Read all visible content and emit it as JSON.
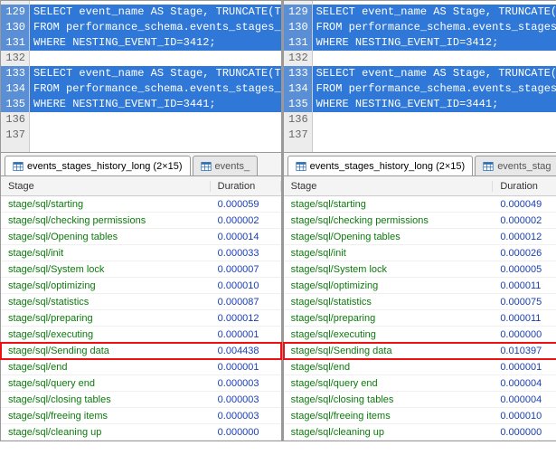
{
  "left": {
    "editor": {
      "lines": [
        {
          "n": "129",
          "text": "SELECT event_name AS Stage, TRUNCATE(T",
          "sel": true
        },
        {
          "n": "130",
          "text": "FROM performance_schema.events_stages_",
          "sel": true
        },
        {
          "n": "131",
          "text": "WHERE NESTING_EVENT_ID=3412;",
          "sel": true
        },
        {
          "n": "132",
          "text": "",
          "sel": false
        },
        {
          "n": "133",
          "text": "SELECT event_name AS Stage, TRUNCATE(T",
          "sel": true
        },
        {
          "n": "134",
          "text": "FROM performance_schema.events_stages_",
          "sel": true
        },
        {
          "n": "135",
          "text": "WHERE NESTING_EVENT_ID=3441;",
          "sel": true
        },
        {
          "n": "136",
          "text": "",
          "sel": false
        },
        {
          "n": "137",
          "text": "",
          "sel": false
        }
      ]
    },
    "tabs": [
      {
        "label": "events_stages_history_long (2×15)",
        "active": true
      },
      {
        "label": "events_",
        "active": false
      }
    ],
    "grid": {
      "headers": {
        "stage": "Stage",
        "duration": "Duration"
      },
      "rows": [
        {
          "stage": "stage/sql/starting",
          "duration": "0.000059",
          "hl": false
        },
        {
          "stage": "stage/sql/checking permissions",
          "duration": "0.000002",
          "hl": false
        },
        {
          "stage": "stage/sql/Opening tables",
          "duration": "0.000014",
          "hl": false
        },
        {
          "stage": "stage/sql/init",
          "duration": "0.000033",
          "hl": false
        },
        {
          "stage": "stage/sql/System lock",
          "duration": "0.000007",
          "hl": false
        },
        {
          "stage": "stage/sql/optimizing",
          "duration": "0.000010",
          "hl": false
        },
        {
          "stage": "stage/sql/statistics",
          "duration": "0.000087",
          "hl": false
        },
        {
          "stage": "stage/sql/preparing",
          "duration": "0.000012",
          "hl": false
        },
        {
          "stage": "stage/sql/executing",
          "duration": "0.000001",
          "hl": false
        },
        {
          "stage": "stage/sql/Sending data",
          "duration": "0.004438",
          "hl": true
        },
        {
          "stage": "stage/sql/end",
          "duration": "0.000001",
          "hl": false
        },
        {
          "stage": "stage/sql/query end",
          "duration": "0.000003",
          "hl": false
        },
        {
          "stage": "stage/sql/closing tables",
          "duration": "0.000003",
          "hl": false
        },
        {
          "stage": "stage/sql/freeing items",
          "duration": "0.000003",
          "hl": false
        },
        {
          "stage": "stage/sql/cleaning up",
          "duration": "0.000000",
          "hl": false
        }
      ]
    }
  },
  "right": {
    "editor": {
      "lines": [
        {
          "n": "129",
          "text": "SELECT event_name AS Stage, TRUNCATE(T",
          "sel": true
        },
        {
          "n": "130",
          "text": "FROM performance_schema.events_stages_",
          "sel": true
        },
        {
          "n": "131",
          "text": "WHERE NESTING_EVENT_ID=3412;",
          "sel": true
        },
        {
          "n": "132",
          "text": "",
          "sel": false
        },
        {
          "n": "133",
          "text": "SELECT event_name AS Stage, TRUNCATE(T",
          "sel": true
        },
        {
          "n": "134",
          "text": "FROM performance_schema.events_stages_",
          "sel": true
        },
        {
          "n": "135",
          "text": "WHERE NESTING_EVENT_ID=3441;",
          "sel": true
        },
        {
          "n": "136",
          "text": "",
          "sel": false
        },
        {
          "n": "137",
          "text": "",
          "sel": false
        }
      ]
    },
    "tabs": [
      {
        "label": "events_stages_history_long (2×15)",
        "active": true
      },
      {
        "label": "events_stag",
        "active": false
      }
    ],
    "grid": {
      "headers": {
        "stage": "Stage",
        "duration": "Duration"
      },
      "rows": [
        {
          "stage": "stage/sql/starting",
          "duration": "0.000049",
          "hl": false
        },
        {
          "stage": "stage/sql/checking permissions",
          "duration": "0.000002",
          "hl": false
        },
        {
          "stage": "stage/sql/Opening tables",
          "duration": "0.000012",
          "hl": false
        },
        {
          "stage": "stage/sql/init",
          "duration": "0.000026",
          "hl": false
        },
        {
          "stage": "stage/sql/System lock",
          "duration": "0.000005",
          "hl": false
        },
        {
          "stage": "stage/sql/optimizing",
          "duration": "0.000011",
          "hl": false
        },
        {
          "stage": "stage/sql/statistics",
          "duration": "0.000075",
          "hl": false
        },
        {
          "stage": "stage/sql/preparing",
          "duration": "0.000011",
          "hl": false
        },
        {
          "stage": "stage/sql/executing",
          "duration": "0.000000",
          "hl": false
        },
        {
          "stage": "stage/sql/Sending data",
          "duration": "0.010397",
          "hl": true
        },
        {
          "stage": "stage/sql/end",
          "duration": "0.000001",
          "hl": false
        },
        {
          "stage": "stage/sql/query end",
          "duration": "0.000004",
          "hl": false
        },
        {
          "stage": "stage/sql/closing tables",
          "duration": "0.000004",
          "hl": false
        },
        {
          "stage": "stage/sql/freeing items",
          "duration": "0.000010",
          "hl": false
        },
        {
          "stage": "stage/sql/cleaning up",
          "duration": "0.000000",
          "hl": false
        }
      ]
    }
  },
  "chart_data": [
    {
      "type": "table",
      "title": "events_stages_history_long (left, NESTING_EVENT_ID=3412)",
      "columns": [
        "Stage",
        "Duration"
      ],
      "rows": [
        [
          "stage/sql/starting",
          5.9e-05
        ],
        [
          "stage/sql/checking permissions",
          2e-06
        ],
        [
          "stage/sql/Opening tables",
          1.4e-05
        ],
        [
          "stage/sql/init",
          3.3e-05
        ],
        [
          "stage/sql/System lock",
          7e-06
        ],
        [
          "stage/sql/optimizing",
          1e-05
        ],
        [
          "stage/sql/statistics",
          8.7e-05
        ],
        [
          "stage/sql/preparing",
          1.2e-05
        ],
        [
          "stage/sql/executing",
          1e-06
        ],
        [
          "stage/sql/Sending data",
          0.004438
        ],
        [
          "stage/sql/end",
          1e-06
        ],
        [
          "stage/sql/query end",
          3e-06
        ],
        [
          "stage/sql/closing tables",
          3e-06
        ],
        [
          "stage/sql/freeing items",
          3e-06
        ],
        [
          "stage/sql/cleaning up",
          0.0
        ]
      ]
    },
    {
      "type": "table",
      "title": "events_stages_history_long (right, NESTING_EVENT_ID=3441)",
      "columns": [
        "Stage",
        "Duration"
      ],
      "rows": [
        [
          "stage/sql/starting",
          4.9e-05
        ],
        [
          "stage/sql/checking permissions",
          2e-06
        ],
        [
          "stage/sql/Opening tables",
          1.2e-05
        ],
        [
          "stage/sql/init",
          2.6e-05
        ],
        [
          "stage/sql/System lock",
          5e-06
        ],
        [
          "stage/sql/optimizing",
          1.1e-05
        ],
        [
          "stage/sql/statistics",
          7.5e-05
        ],
        [
          "stage/sql/preparing",
          1.1e-05
        ],
        [
          "stage/sql/executing",
          0.0
        ],
        [
          "stage/sql/Sending data",
          0.010397
        ],
        [
          "stage/sql/end",
          1e-06
        ],
        [
          "stage/sql/query end",
          4e-06
        ],
        [
          "stage/sql/closing tables",
          4e-06
        ],
        [
          "stage/sql/freeing items",
          1e-05
        ],
        [
          "stage/sql/cleaning up",
          0.0
        ]
      ]
    }
  ]
}
